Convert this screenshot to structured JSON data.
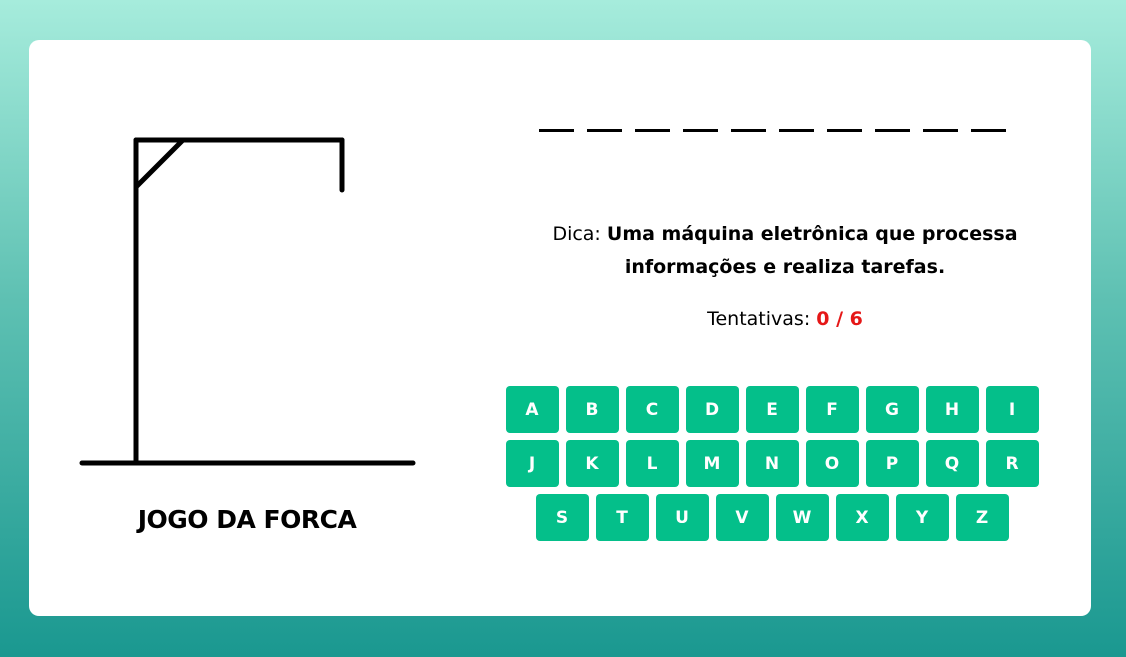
{
  "game": {
    "title": "JOGO DA FORCA"
  },
  "word": {
    "letters": [
      "",
      "",
      "",
      "",
      "",
      "",
      "",
      "",
      "",
      ""
    ]
  },
  "hint": {
    "label": "Dica: ",
    "text": "Uma máquina eletrônica que processa informações e realiza tarefas."
  },
  "attempts": {
    "label": "Tentativas: ",
    "count": "0 / 6"
  },
  "keyboard": {
    "keys": [
      "A",
      "B",
      "C",
      "D",
      "E",
      "F",
      "G",
      "H",
      "I",
      "J",
      "K",
      "L",
      "M",
      "N",
      "O",
      "P",
      "Q",
      "R",
      "S",
      "T",
      "U",
      "V",
      "W",
      "X",
      "Y",
      "Z"
    ]
  },
  "colors": {
    "key_bg": "#04bf8a",
    "attempts_count": "#e51717",
    "background_top": "#a6ecdc",
    "background_bottom": "#1a9890"
  }
}
